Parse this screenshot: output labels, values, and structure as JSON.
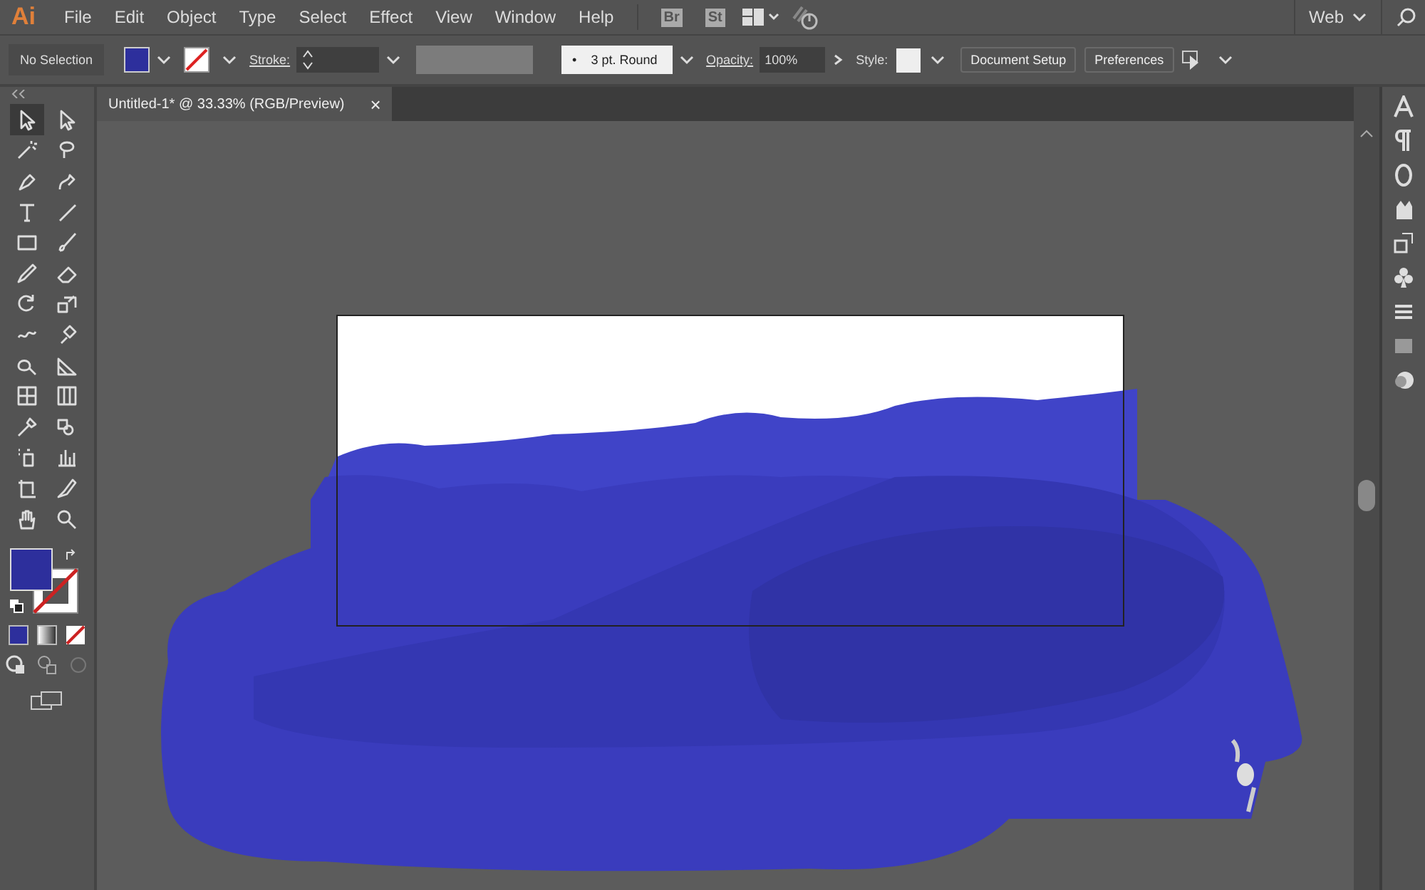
{
  "app_logo": "Ai",
  "menu": [
    "File",
    "Edit",
    "Object",
    "Type",
    "Select",
    "Effect",
    "View",
    "Window",
    "Help"
  ],
  "bridge": "Br",
  "stock": "St",
  "workspace": "Web",
  "control_bar": {
    "selection": "No Selection",
    "fill_swatch": {
      "color": "#2d2f9c"
    },
    "brush_marker": "•",
    "stroke_label": "Stroke:",
    "brush": "3 pt. Round",
    "opacity_label": "Opacity:",
    "opacity": "100%",
    "style_label": "Style:",
    "buttons": [
      "Document Setup",
      "Preferences"
    ]
  },
  "document_tab": {
    "title": "Untitled-1* @ 33.33% (RGB/Preview)",
    "close": "×"
  },
  "tools": [
    {
      "selected": true
    },
    {
      "selected": false
    },
    {
      "selected": false
    },
    {
      "selected": false
    },
    {
      "selected": false
    },
    {
      "selected": false
    },
    {
      "selected": false
    },
    {
      "selected": false
    },
    {
      "selected": false
    },
    {
      "selected": false
    },
    {
      "selected": false
    },
    {
      "selected": false
    },
    {
      "selected": false
    },
    {
      "selected": false
    },
    {
      "selected": false
    },
    {
      "selected": false
    },
    {
      "selected": false
    },
    {
      "selected": false
    },
    {
      "selected": false
    },
    {
      "selected": false
    },
    {
      "selected": false
    },
    {
      "selected": false
    },
    {
      "selected": false
    },
    {
      "selected": false
    },
    {
      "selected": false
    },
    {
      "selected": false
    },
    {
      "selected": false
    },
    {
      "selected": false
    }
  ]
}
